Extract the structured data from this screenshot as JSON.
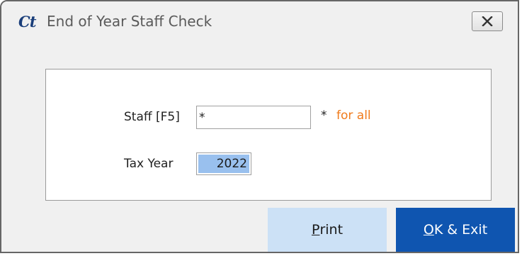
{
  "window": {
    "app_logo_text": "Ct",
    "title": "End of Year Staff Check",
    "close_icon": "close-x-icon"
  },
  "form": {
    "staff_label": "Staff [F5]",
    "staff_value": "*",
    "staff_hint_symbol": "*",
    "staff_hint_text": "for all",
    "tax_year_label": "Tax Year",
    "tax_year_value": "2022"
  },
  "buttons": {
    "print_mnemonic": "P",
    "print_rest": "rint",
    "ok_mnemonic": "O",
    "ok_rest": "K & Exit"
  },
  "colors": {
    "hint_orange": "#f07a1a",
    "primary_button": "#0f55b0",
    "secondary_button": "#cce1f6",
    "selection": "#99c0ee"
  }
}
